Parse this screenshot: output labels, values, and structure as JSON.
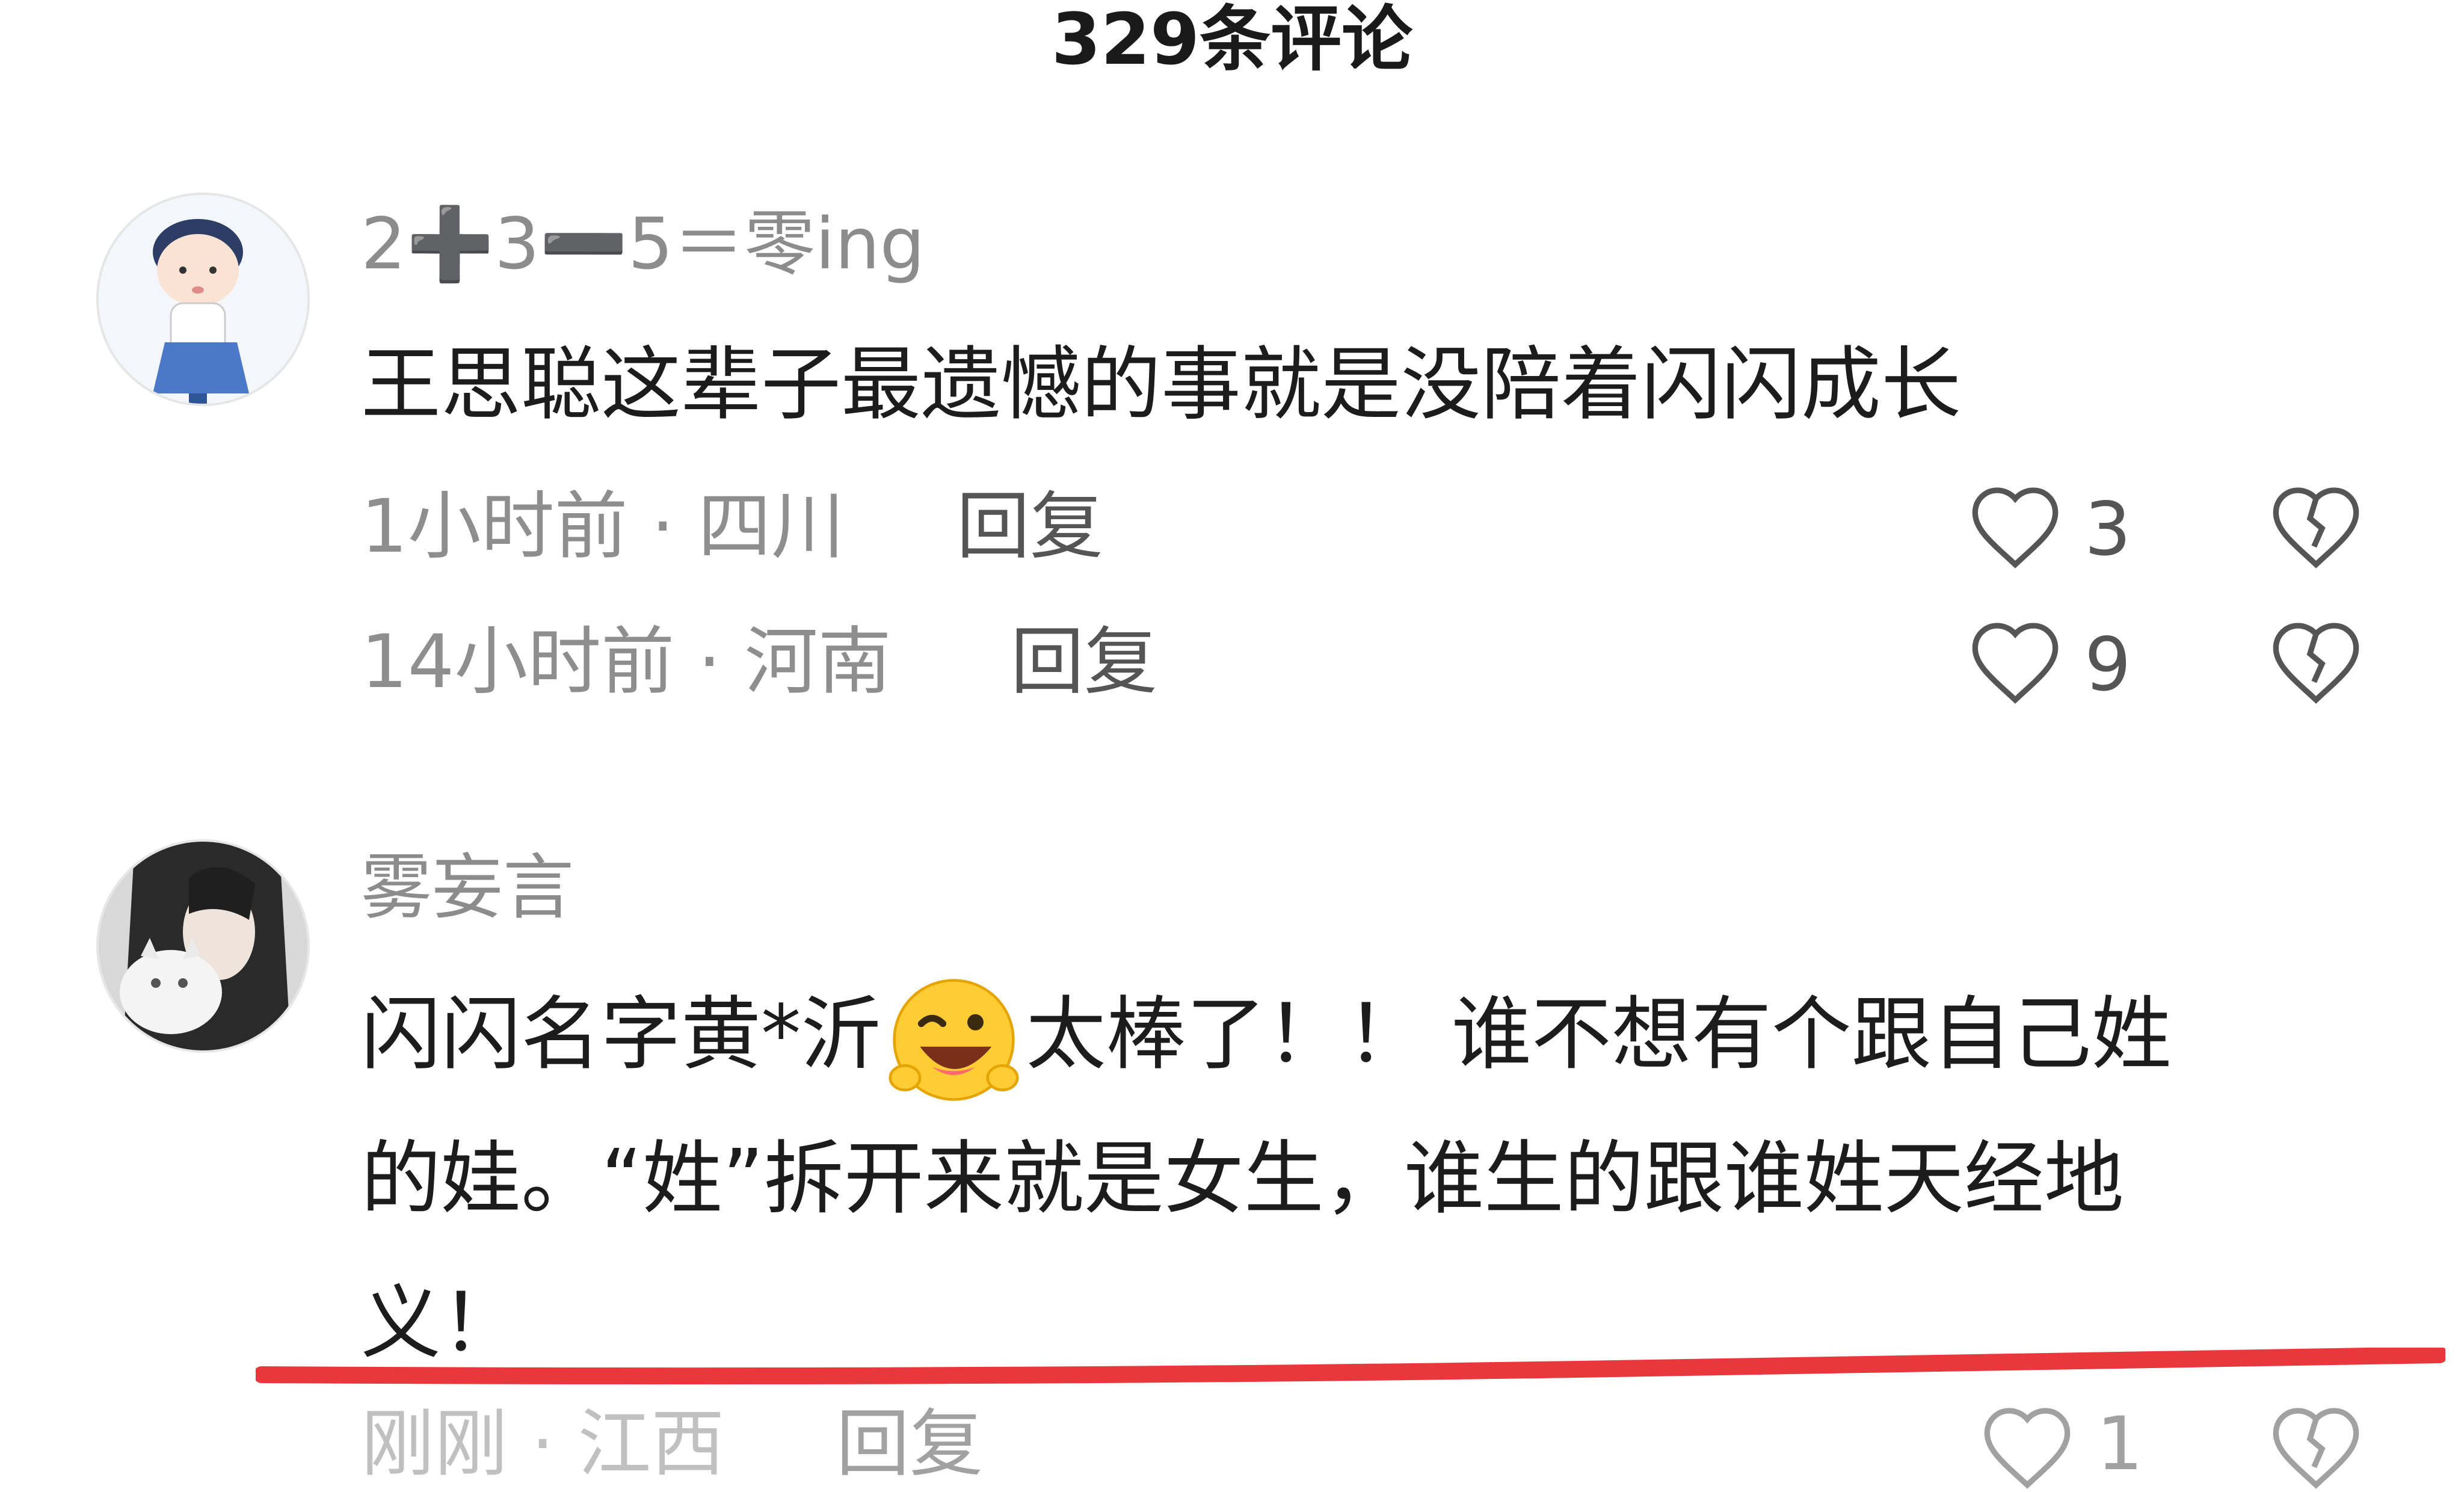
{
  "header": {
    "title": "329条评论"
  },
  "comments": [
    {
      "username": "2➕3➖5＝零ing",
      "text": "王思聪这辈子最遗憾的事就是没陪着闪闪成长",
      "replies_rows": [
        {
          "time_location": "1小时前 · 四川",
          "reply_label": "回复",
          "likes": "3"
        },
        {
          "time_location": "14小时前 · 河南",
          "reply_label": "回复",
          "likes": "9"
        }
      ]
    },
    {
      "username": "雾妄言",
      "text_line1_a": "闪闪名字黄*沂",
      "text_line1_b": "太棒了！！ 谁不想有个跟自己姓",
      "text_line2": "的娃。“姓”拆开来就是女生，谁生的跟谁姓天经地",
      "text_line3": "义！",
      "emoji": "grinning-wink-emoji"
    }
  ],
  "next_row_partial": {
    "time_location": "刚刚 · 江西",
    "reply_label": "回复",
    "likes": "1"
  },
  "colors": {
    "underline": "#e8383d",
    "meta_gray": "#8e8e8e",
    "text": "#1c1c1c"
  }
}
